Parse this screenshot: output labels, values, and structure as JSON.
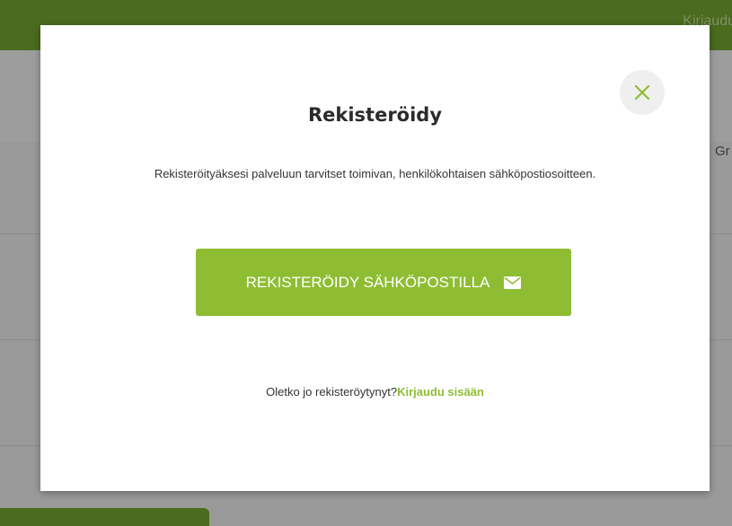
{
  "background": {
    "topbar_login": "Kirjaudu",
    "subheader_text": "Gr"
  },
  "modal": {
    "title": "Rekisteröidy",
    "description": "Rekisteröityäksesi palveluun tarvitset toimivan, henkilökohtaisen sähköpostiosoitteen.",
    "register_button_label": "REKISTERÖIDY SÄHKÖPOSTILLA",
    "register_button_icon": "envelope-icon",
    "close_icon": "close-icon",
    "footer_text": "Oletko jo rekisteröytynyt?",
    "login_link": "Kirjaudu sisään"
  },
  "colors": {
    "accent": "#8ebd33",
    "topbar": "#4b6b1e"
  }
}
